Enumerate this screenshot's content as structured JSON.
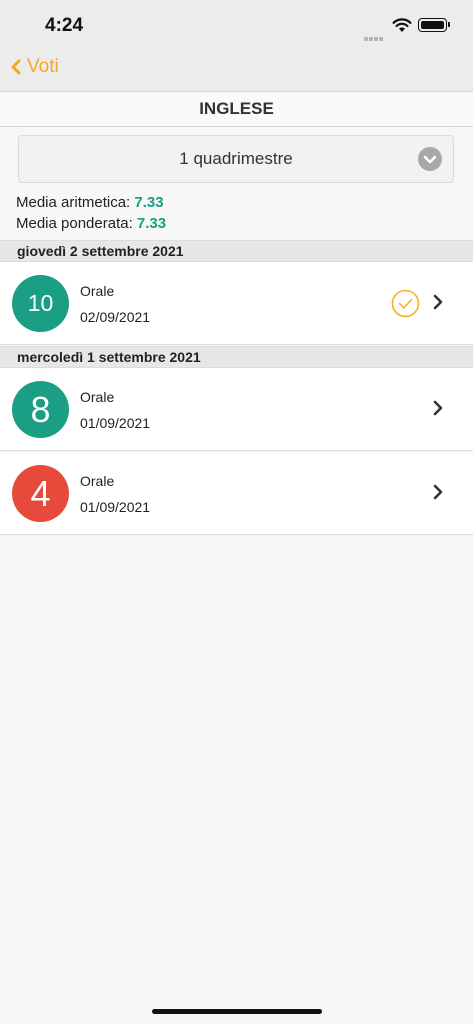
{
  "status_bar": {
    "time": "4:24"
  },
  "nav": {
    "back_label": "Voti"
  },
  "subject": {
    "title": "INGLESE"
  },
  "period": {
    "selected": "1 quadrimestre"
  },
  "averages": {
    "arithmetic_label": "Media aritmetica:",
    "arithmetic_value": "7.33",
    "weighted_label": "Media ponderata:",
    "weighted_value": "7.33"
  },
  "sections": [
    {
      "date_header": "giovedì 2 settembre 2021",
      "grades": [
        {
          "value": "10",
          "type": "Orale",
          "date": "02/09/2021",
          "color": "#1a9e84",
          "checked": true
        }
      ]
    },
    {
      "date_header": "mercoledì 1 settembre 2021",
      "grades": [
        {
          "value": "8",
          "type": "Orale",
          "date": "01/09/2021",
          "color": "#1a9e84",
          "checked": false
        },
        {
          "value": "4",
          "type": "Orale",
          "date": "01/09/2021",
          "color": "#e64a3b",
          "checked": false
        }
      ]
    }
  ],
  "colors": {
    "accent": "#f5a623",
    "positive": "#1a9e84",
    "negative": "#e64a3b"
  }
}
